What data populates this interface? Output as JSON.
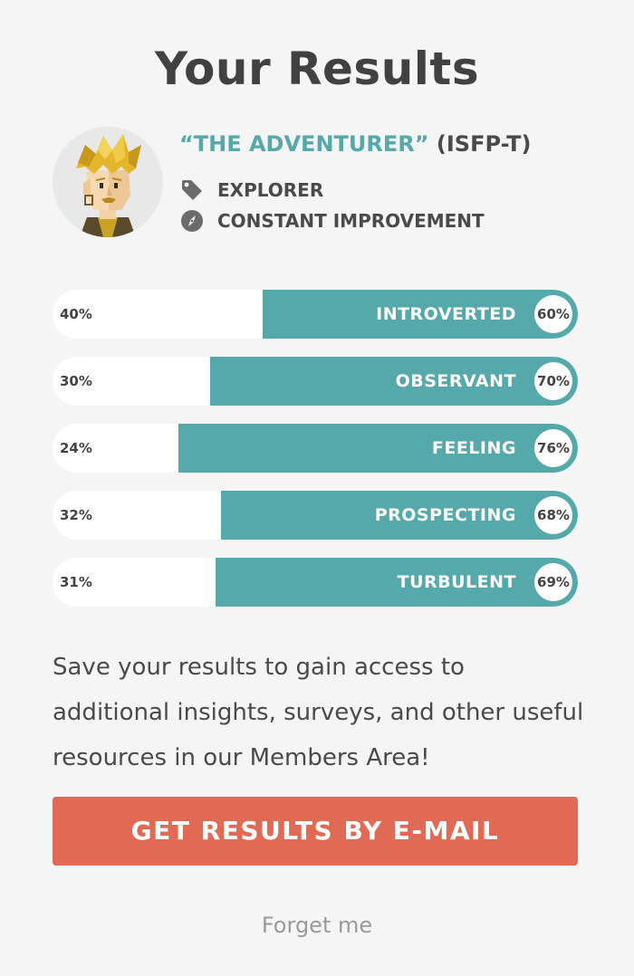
{
  "header": {
    "title": "Your Results"
  },
  "profile": {
    "avatar_icon": "adventurer-avatar",
    "type_name": "“THE ADVENTURER”",
    "type_code": "(ISFP-T)",
    "traits": [
      {
        "icon": "tag-icon",
        "label": "EXPLORER"
      },
      {
        "icon": "compass-icon",
        "label": "CONSTANT IMPROVEMENT"
      }
    ]
  },
  "bars": [
    {
      "left_pct": "40%",
      "label": "INTROVERTED",
      "right_pct": "60%",
      "value": 60
    },
    {
      "left_pct": "30%",
      "label": "OBSERVANT",
      "right_pct": "70%",
      "value": 70
    },
    {
      "left_pct": "24%",
      "label": "FEELING",
      "right_pct": "76%",
      "value": 76
    },
    {
      "left_pct": "32%",
      "label": "PROSPECTING",
      "right_pct": "68%",
      "value": 68
    },
    {
      "left_pct": "31%",
      "label": "TURBULENT",
      "right_pct": "69%",
      "value": 69
    }
  ],
  "description": "Save your results to gain access to additional insights, surveys, and other useful resources in our Members Area!",
  "cta": {
    "label": "GET RESULTS BY E-MAIL"
  },
  "forget": {
    "label": "Forget me"
  },
  "colors": {
    "accent": "#56a9aa",
    "cta": "#e06a54",
    "background": "#f5f5f5"
  }
}
